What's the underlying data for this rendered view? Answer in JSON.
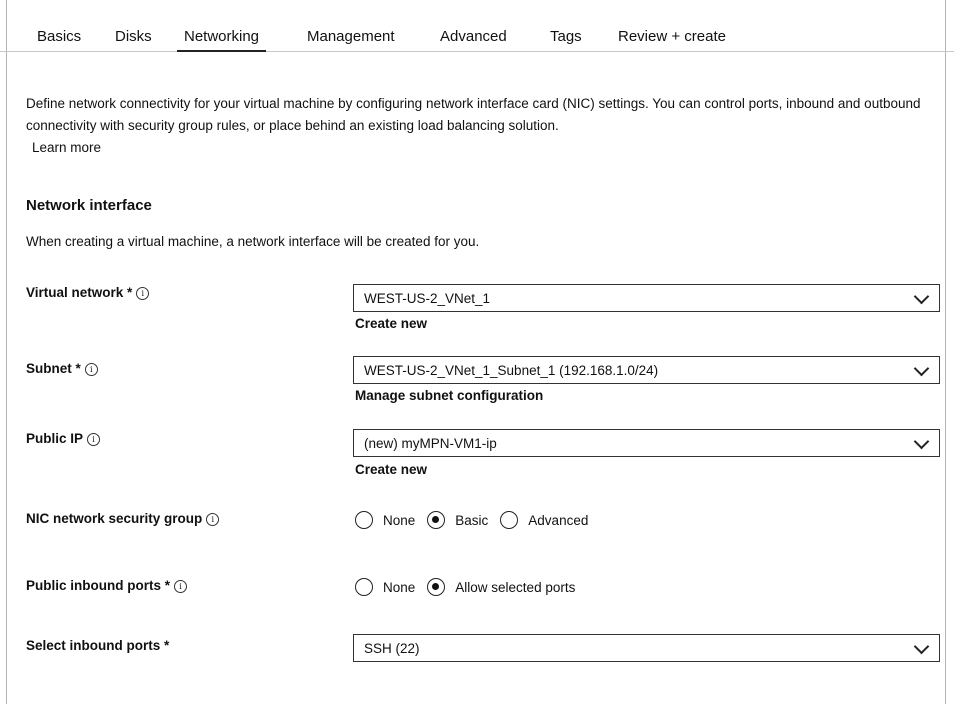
{
  "tabs": [
    {
      "label": "Basics"
    },
    {
      "label": "Disks"
    },
    {
      "label": "Networking"
    },
    {
      "label": "Management"
    },
    {
      "label": "Advanced"
    },
    {
      "label": "Tags"
    },
    {
      "label": "Review + create"
    }
  ],
  "active_tab": "Networking",
  "intro": {
    "text": "Define network connectivity for your virtual machine by configuring network interface card (NIC) settings. You can control ports, inbound and outbound connectivity with security group rules, or place behind an existing load balancing solution.",
    "learn_more": "Learn more"
  },
  "network_interface": {
    "title": "Network interface",
    "description": "When creating a virtual machine, a network interface will be created for you."
  },
  "fields": {
    "virtual_network": {
      "label": "Virtual network *",
      "value": "WEST-US-2_VNet_1",
      "link": "Create new"
    },
    "subnet": {
      "label": "Subnet *",
      "value": "WEST-US-2_VNet_1_Subnet_1 (192.168.1.0/24)",
      "link": "Manage subnet configuration"
    },
    "public_ip": {
      "label": "Public IP",
      "value": "(new) myMPN-VM1-ip",
      "link": "Create new"
    },
    "nic_nsg": {
      "label": "NIC network security group",
      "options": [
        "None",
        "Basic",
        "Advanced"
      ],
      "selected": "Basic"
    },
    "public_inbound_ports": {
      "label": "Public inbound ports *",
      "options": [
        "None",
        "Allow selected ports"
      ],
      "selected": "Allow selected ports"
    },
    "select_inbound_ports": {
      "label": "Select inbound ports *",
      "value": "SSH (22)"
    }
  },
  "info_glyph": "ⓘ"
}
